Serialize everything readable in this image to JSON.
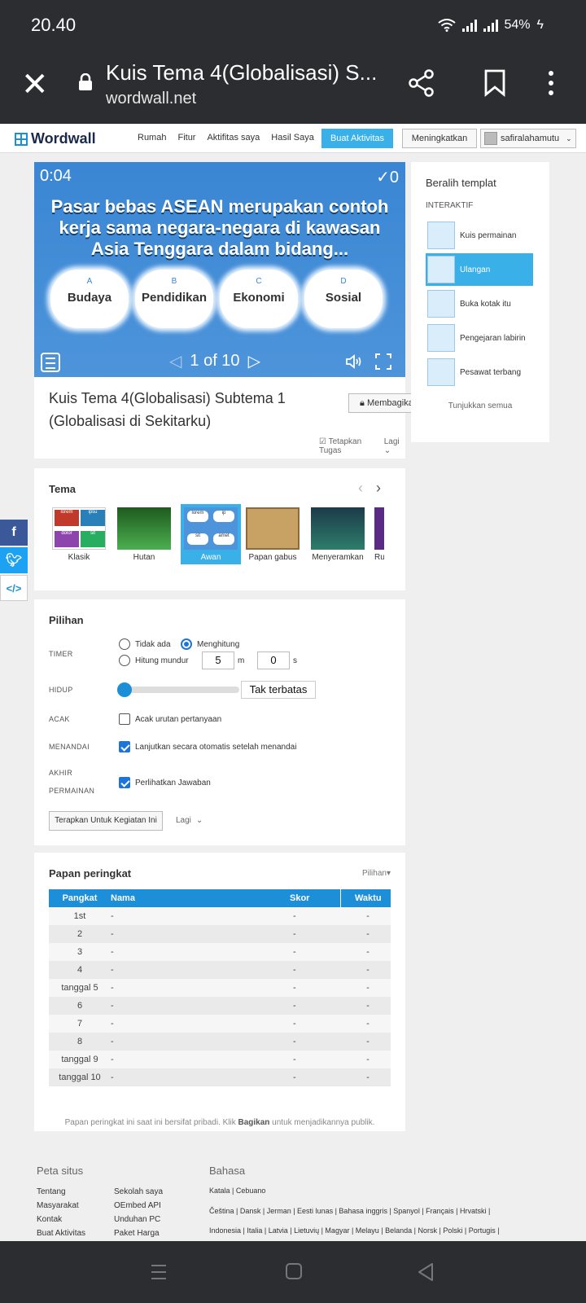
{
  "status": {
    "time": "20.40",
    "battery": "54%"
  },
  "browser": {
    "title": "Kuis Tema 4(Globalisasi) S...",
    "domain": "wordwall.net"
  },
  "site": {
    "logo": "Wordwall",
    "nav": [
      "Rumah",
      "Fitur",
      "Aktifitas saya",
      "Hasil Saya"
    ],
    "create_button": "Buat Aktivitas",
    "upgrade_button": "Meningkatkan",
    "username": "safiralahamutu"
  },
  "game": {
    "timer": "0:04",
    "score": "0",
    "question": "Pasar bebas ASEAN merupakan contoh kerja sama negara-negara di kawasan Asia Tenggara dalam bidang...",
    "answers": [
      {
        "letter": "A",
        "text": "Budaya"
      },
      {
        "letter": "B",
        "text": "Pendidikan"
      },
      {
        "letter": "C",
        "text": "Ekonomi"
      },
      {
        "letter": "D",
        "text": "Sosial"
      }
    ],
    "page": "1 of 10"
  },
  "activity": {
    "title": "Kuis Tema 4(Globalisasi) Subtema 1 (Globalisasi di Sekitarku)",
    "share_button": "Membagikan",
    "assign": "Tetapkan Tugas",
    "more": "Lagi"
  },
  "templates": {
    "heading": "Beralih templat",
    "section": "INTERAKTIF",
    "items": [
      "Kuis permainan",
      "Ulangan",
      "Buka kotak itu",
      "Pengejaran labirin",
      "Pesawat terbang"
    ],
    "show_all": "Tunjukkan semua"
  },
  "theme": {
    "heading": "Tema",
    "items": [
      "Klasik",
      "Hutan",
      "Awan",
      "Papan gabus",
      "Menyeramkan",
      "Ru"
    ],
    "thumb_words_klasik": [
      "lorem",
      "ipsu",
      "dolor",
      "sit"
    ],
    "thumb_words_awan": [
      "lorem",
      "ip",
      "sit",
      "amet"
    ]
  },
  "options": {
    "heading": "Pilihan",
    "timer_label": "TIMER",
    "timer_none": "Tidak ada",
    "timer_count": "Menghitung",
    "timer_down": "Hitung mundur",
    "minutes": "5",
    "m": "m",
    "seconds": "0",
    "s": "s",
    "lives_label": "HIDUP",
    "lives_value": "Tak terbatas",
    "shuffle_label": "ACAK",
    "shuffle_text": "Acak urutan pertanyaan",
    "mark_label": "MENANDAI",
    "mark_text": "Lanjutkan secara otomatis setelah menandai",
    "end_label1": "AKHIR",
    "end_label2": "PERMAINAN",
    "end_text": "Perlihatkan Jawaban",
    "apply_button": "Terapkan Untuk Kegiatan Ini",
    "more": "Lagi"
  },
  "leaderboard": {
    "heading": "Papan peringkat",
    "options": "Pilihan",
    "columns": [
      "Pangkat",
      "Nama",
      "Skor",
      "Waktu"
    ],
    "rows": [
      [
        "1st",
        "-",
        "-",
        "-"
      ],
      [
        "2",
        "-",
        "-",
        "-"
      ],
      [
        "3",
        "-",
        "-",
        "-"
      ],
      [
        "4",
        "-",
        "-",
        "-"
      ],
      [
        "tanggal 5",
        "-",
        "-",
        "-"
      ],
      [
        "6",
        "-",
        "-",
        "-"
      ],
      [
        "7",
        "-",
        "-",
        "-"
      ],
      [
        "8",
        "-",
        "-",
        "-"
      ],
      [
        "tanggal 9",
        "-",
        "-",
        "-"
      ],
      [
        "tanggal 10",
        "-",
        "-",
        "-"
      ]
    ],
    "note_pre": "Papan peringkat ini saat ini bersifat pribadi. Klik ",
    "note_link": "Bagikan",
    "note_post": " untuk menjadikannya publik."
  },
  "footer": {
    "sitemap_heading": "Peta situs",
    "col1": [
      "Tentang",
      "Masyarakat",
      "Kontak",
      "Buat Aktivitas"
    ],
    "col2": [
      "Sekolah saya",
      "OEmbed API",
      "Unduhan PC",
      "Paket Harga"
    ],
    "lang_heading": "Bahasa",
    "lang_line1": "Katala | Cebuano",
    "lang_line2": "Čeština | Dansk | Jerman | Eesti lunas | Bahasa inggris | Spanyol | Français | Hrvatski |",
    "lang_line3": "Indonesia | Italia | Latvia | Lietuvių | Magyar | Melayu | Belanda | Norsk | Polski | Portugis |"
  }
}
